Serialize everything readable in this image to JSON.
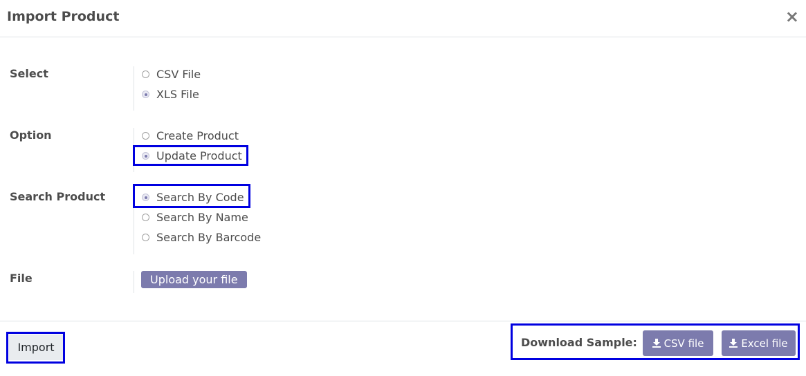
{
  "dialog": {
    "title": "Import Product",
    "close_label": "×"
  },
  "form": {
    "select": {
      "label": "Select",
      "options": [
        {
          "label": "CSV File",
          "checked": false
        },
        {
          "label": "XLS File",
          "checked": true
        }
      ]
    },
    "option": {
      "label": "Option",
      "options": [
        {
          "label": "Create Product",
          "checked": false
        },
        {
          "label": "Update Product",
          "checked": true
        }
      ]
    },
    "search_product": {
      "label": "Search Product",
      "options": [
        {
          "label": "Search By Code",
          "checked": true
        },
        {
          "label": "Search By Name",
          "checked": false
        },
        {
          "label": "Search By Barcode",
          "checked": false
        }
      ]
    },
    "file": {
      "label": "File",
      "upload_label": "Upload your file"
    }
  },
  "footer": {
    "import_label": "Import",
    "download_label": "Download Sample:",
    "csv_label": "CSV file",
    "excel_label": "Excel file"
  },
  "colors": {
    "accent": "#7c7bad",
    "highlight": "#0000e0"
  }
}
